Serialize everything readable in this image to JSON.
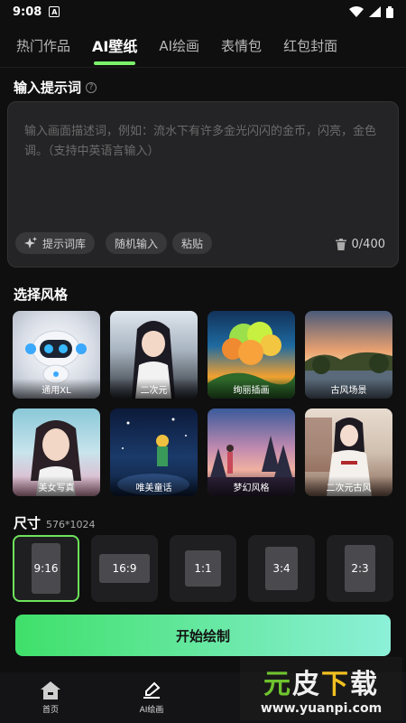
{
  "status": {
    "time": "9:08"
  },
  "tabs": [
    {
      "label": "热门作品"
    },
    {
      "label": "AI壁纸"
    },
    {
      "label": "AI绘画"
    },
    {
      "label": "表情包"
    },
    {
      "label": "红包封面"
    }
  ],
  "prompt": {
    "title": "输入提示词",
    "placeholder": "输入画面描述词，例如：流水下有许多金光闪闪的金币，闪亮，金色调。（支持中英语言输入）",
    "library_label": "提示词库",
    "random_label": "随机输入",
    "paste_label": "粘贴",
    "counter": "0/400"
  },
  "styles": {
    "title": "选择风格",
    "items": [
      {
        "label": "通用XL"
      },
      {
        "label": "二次元"
      },
      {
        "label": "绚丽插画"
      },
      {
        "label": "古风场景"
      },
      {
        "label": "美女写真"
      },
      {
        "label": "唯美童话"
      },
      {
        "label": "梦幻风格"
      },
      {
        "label": "二次元古风"
      }
    ]
  },
  "size": {
    "title": "尺寸",
    "resolution": "576*1024",
    "options": [
      {
        "label": "9:16"
      },
      {
        "label": "16:9"
      },
      {
        "label": "1:1"
      },
      {
        "label": "3:4"
      },
      {
        "label": "2:3"
      }
    ],
    "selected": "9:16"
  },
  "start_button": "开始绘制",
  "nav": [
    {
      "label": "首页"
    },
    {
      "label": "AI绘画"
    }
  ],
  "watermark": {
    "part1": "元",
    "part2": "皮",
    "part3": "下",
    "part4": "载",
    "url": "www.yuanpi.com"
  },
  "colors": {
    "accent": "#7cf26a",
    "background": "#0f0f10",
    "panel": "#242426"
  }
}
